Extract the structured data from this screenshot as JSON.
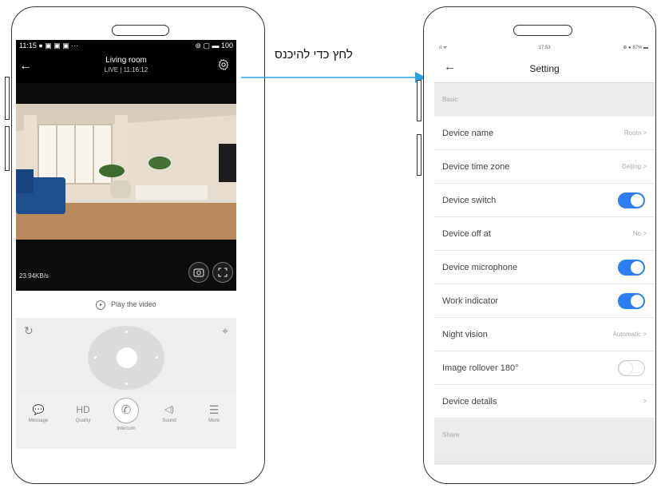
{
  "annotation": {
    "text": "לחץ כדי להיכנס"
  },
  "left_screen": {
    "status_time": "11:15 ● ▣ ▣ ▣ ···",
    "status_right": "⊚ ▢ ▬ 100",
    "camera_name": "Living room",
    "live_status": "LIVE | 11:16:12",
    "speed": "23.94KB/s",
    "play_label": "Play the video",
    "tabs": [
      {
        "icon": "💬",
        "label": "Message"
      },
      {
        "icon": "HD",
        "label": "Quality"
      },
      {
        "icon": "✆",
        "label": "Intercom"
      },
      {
        "icon": "◁)",
        "label": "Sound"
      },
      {
        "icon": "☰",
        "label": "More"
      }
    ]
  },
  "right_screen": {
    "status_left": "ıl ᯤ",
    "status_time": "17:53",
    "status_right": "⊕ ● 87% ▬",
    "title": "Setting",
    "section_basic": "Basic",
    "section_share": "Share",
    "rows": [
      {
        "label": "Device name",
        "value": "Room >"
      },
      {
        "label": "Device time zone",
        "value": "Beijing >"
      },
      {
        "label": "Device switch",
        "toggle": true
      },
      {
        "label": "Device off at",
        "value": "No >"
      },
      {
        "label": "Device microphone",
        "toggle": true
      },
      {
        "label": "Work indicator",
        "toggle": true
      },
      {
        "label": "Night vision",
        "value": "Automatic >"
      },
      {
        "label": "Image rollover 180°",
        "toggle": false
      },
      {
        "label": "Device details",
        "value": ">"
      }
    ]
  },
  "colors": {
    "accent": "#2f7ef0",
    "arrow": "#29a3e0"
  }
}
